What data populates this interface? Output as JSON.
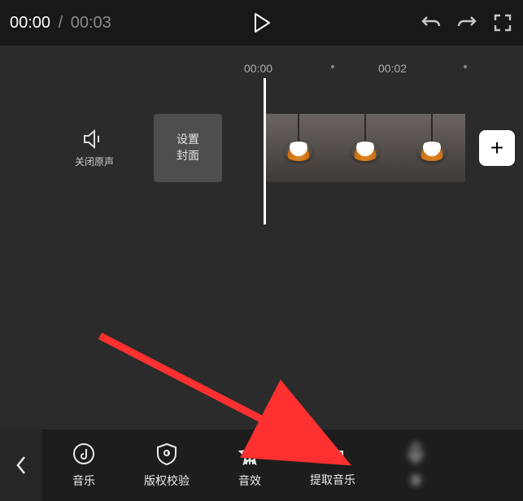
{
  "topbar": {
    "current_time": "00:00",
    "total_time": "00:03"
  },
  "ruler": {
    "tick_0": "00:00",
    "tick_2": "00:02"
  },
  "track": {
    "mute_label": "关闭原声",
    "cover_label": "设置\n封面",
    "add_label": "+"
  },
  "bottom": {
    "tabs": [
      {
        "name": "music",
        "label": "音乐"
      },
      {
        "name": "copyright",
        "label": "版权校验"
      },
      {
        "name": "sfx",
        "label": "音效"
      },
      {
        "name": "extract",
        "label": "提取音乐"
      },
      {
        "name": "record",
        "label": "录"
      }
    ]
  }
}
